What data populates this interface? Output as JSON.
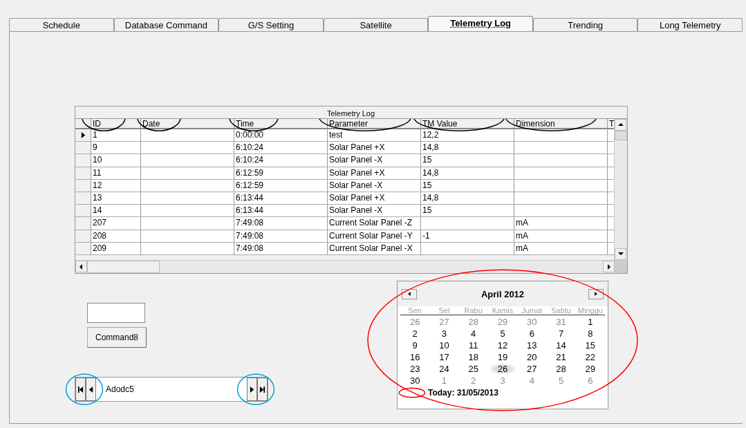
{
  "tabs": [
    {
      "label": "Schedule",
      "selected": false
    },
    {
      "label": "Database Command",
      "selected": false
    },
    {
      "label": "G/S Setting",
      "selected": false
    },
    {
      "label": "Satellite",
      "selected": false
    },
    {
      "label": "Telemetry Log",
      "selected": true
    },
    {
      "label": "Trending",
      "selected": false
    },
    {
      "label": "Long Telemetry",
      "selected": false
    }
  ],
  "grid": {
    "caption": "Telemetry Log",
    "columns": [
      {
        "label": "ID",
        "annotated": true
      },
      {
        "label": "Date",
        "annotated": true
      },
      {
        "label": "Time",
        "annotated": true
      },
      {
        "label": "Parameter",
        "annotated": true
      },
      {
        "label": "TM Value",
        "annotated": true
      },
      {
        "label": "Dimension",
        "annotated": true
      },
      {
        "label": "T",
        "annotated": false
      }
    ],
    "rows": [
      {
        "current": true,
        "cells": [
          "1",
          null,
          "0:00:00",
          "test",
          "12,2",
          null,
          null
        ]
      },
      {
        "current": false,
        "cells": [
          "9",
          null,
          "6:10:24",
          "Solar Panel +X",
          "14,8",
          null,
          null
        ]
      },
      {
        "current": false,
        "cells": [
          "10",
          null,
          "6:10:24",
          "Solar Panel -X",
          "15",
          null,
          null
        ]
      },
      {
        "current": false,
        "cells": [
          "11",
          null,
          "6:12:59",
          "Solar Panel +X",
          "14,8",
          null,
          null
        ]
      },
      {
        "current": false,
        "cells": [
          "12",
          null,
          "6:12:59",
          "Solar Panel -X",
          "15",
          null,
          null
        ]
      },
      {
        "current": false,
        "cells": [
          "13",
          null,
          "6:13:44",
          "Solar Panel +X",
          "14,8",
          null,
          null
        ]
      },
      {
        "current": false,
        "cells": [
          "14",
          null,
          "6:13:44",
          "Solar Panel -X",
          "15",
          null,
          null
        ]
      },
      {
        "current": false,
        "cells": [
          "207",
          null,
          "7:49:08",
          "Current Solar Panel -Z",
          null,
          "mA",
          null
        ]
      },
      {
        "current": false,
        "cells": [
          "208",
          null,
          "7:49:08",
          "Current Solar Panel -Y",
          "-1",
          "mA",
          null
        ]
      },
      {
        "current": false,
        "cells": [
          "209",
          null,
          "7:49:08",
          "Current Solar Panel -X",
          null,
          "mA",
          null
        ]
      }
    ]
  },
  "command_button": {
    "label": "Command8"
  },
  "navigator": {
    "caption": "Adodc5",
    "annotated": true
  },
  "calendar": {
    "title": "April 2012",
    "annotated": true,
    "weekdays": [
      "Sen",
      "Sel",
      "Rabu",
      "Kamis",
      "Jumat",
      "Sabtu",
      "Minggu"
    ],
    "weeks": [
      [
        {
          "day": "26",
          "outside": true,
          "selected": false
        },
        {
          "day": "27",
          "outside": true,
          "selected": false
        },
        {
          "day": "28",
          "outside": true,
          "selected": false
        },
        {
          "day": "29",
          "outside": true,
          "selected": false
        },
        {
          "day": "30",
          "outside": true,
          "selected": false
        },
        {
          "day": "31",
          "outside": true,
          "selected": false
        },
        {
          "day": "1",
          "outside": false,
          "selected": false
        }
      ],
      [
        {
          "day": "2",
          "outside": false,
          "selected": false
        },
        {
          "day": "3",
          "outside": false,
          "selected": false
        },
        {
          "day": "4",
          "outside": false,
          "selected": false
        },
        {
          "day": "5",
          "outside": false,
          "selected": false
        },
        {
          "day": "6",
          "outside": false,
          "selected": false
        },
        {
          "day": "7",
          "outside": false,
          "selected": false
        },
        {
          "day": "8",
          "outside": false,
          "selected": false
        }
      ],
      [
        {
          "day": "9",
          "outside": false,
          "selected": false
        },
        {
          "day": "10",
          "outside": false,
          "selected": false
        },
        {
          "day": "11",
          "outside": false,
          "selected": false
        },
        {
          "day": "12",
          "outside": false,
          "selected": false
        },
        {
          "day": "13",
          "outside": false,
          "selected": false
        },
        {
          "day": "14",
          "outside": false,
          "selected": false
        },
        {
          "day": "15",
          "outside": false,
          "selected": false
        }
      ],
      [
        {
          "day": "16",
          "outside": false,
          "selected": false
        },
        {
          "day": "17",
          "outside": false,
          "selected": false
        },
        {
          "day": "18",
          "outside": false,
          "selected": false
        },
        {
          "day": "19",
          "outside": false,
          "selected": false
        },
        {
          "day": "20",
          "outside": false,
          "selected": false
        },
        {
          "day": "21",
          "outside": false,
          "selected": false
        },
        {
          "day": "22",
          "outside": false,
          "selected": false
        }
      ],
      [
        {
          "day": "23",
          "outside": false,
          "selected": false
        },
        {
          "day": "24",
          "outside": false,
          "selected": false
        },
        {
          "day": "25",
          "outside": false,
          "selected": false
        },
        {
          "day": "26",
          "outside": false,
          "selected": true
        },
        {
          "day": "27",
          "outside": false,
          "selected": false
        },
        {
          "day": "28",
          "outside": false,
          "selected": false
        },
        {
          "day": "29",
          "outside": false,
          "selected": false
        }
      ],
      [
        {
          "day": "30",
          "outside": false,
          "selected": false
        },
        {
          "day": "1",
          "outside": true,
          "selected": false
        },
        {
          "day": "2",
          "outside": true,
          "selected": false
        },
        {
          "day": "3",
          "outside": true,
          "selected": false
        },
        {
          "day": "4",
          "outside": true,
          "selected": false
        },
        {
          "day": "5",
          "outside": true,
          "selected": false
        },
        {
          "day": "6",
          "outside": true,
          "selected": false
        }
      ]
    ],
    "today": {
      "label": "Today: 31/05/2013",
      "annotated": true
    }
  }
}
